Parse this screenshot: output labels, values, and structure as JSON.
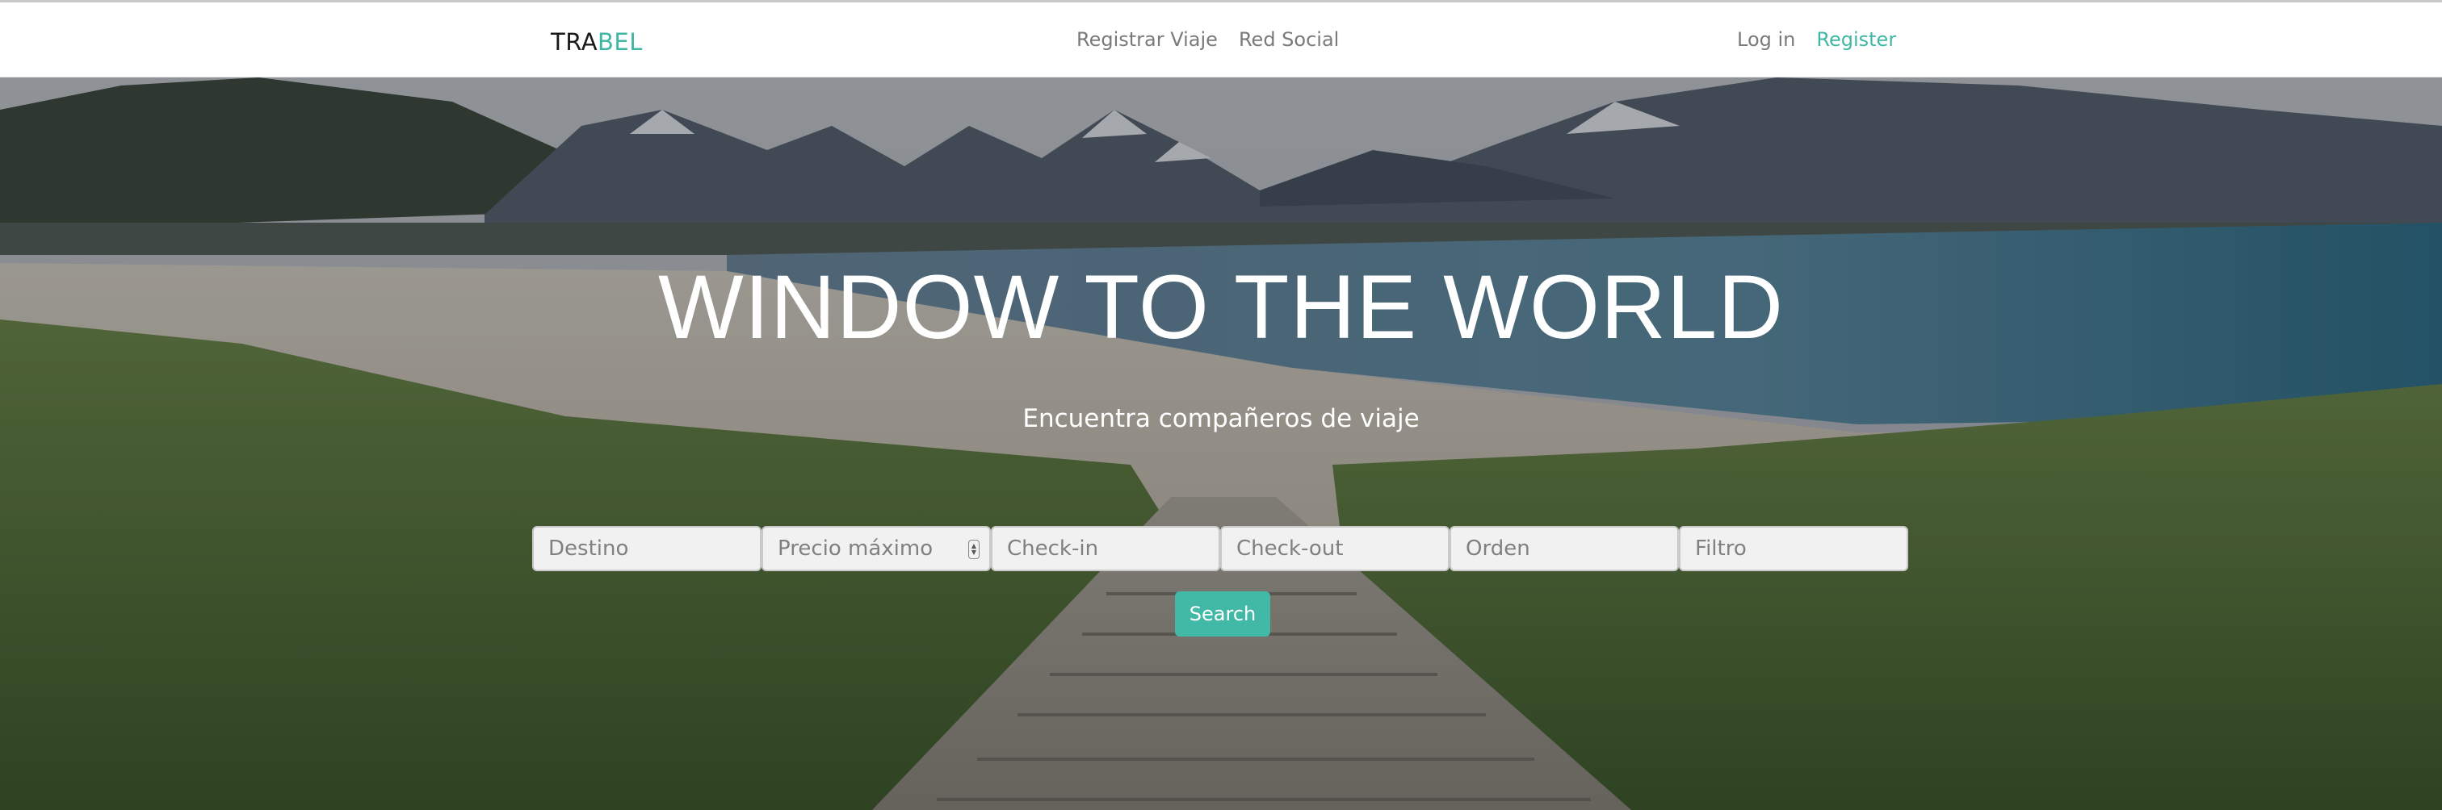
{
  "brand": {
    "prefix": "TRA",
    "accent": "BEL"
  },
  "nav": {
    "center": [
      {
        "label": "Registrar Viaje"
      },
      {
        "label": "Red Social"
      }
    ],
    "login": "Log in",
    "register": "Register"
  },
  "hero": {
    "title": "WINDOW TO THE WORLD",
    "subtitle": "Encuentra compañeros de viaje"
  },
  "search": {
    "fields": [
      {
        "placeholder": "Destino"
      },
      {
        "placeholder": "Precio máximo"
      },
      {
        "placeholder": "Check-in"
      },
      {
        "placeholder": "Check-out"
      },
      {
        "placeholder": "Orden"
      },
      {
        "placeholder": "Filtro"
      }
    ],
    "button": "Search"
  },
  "colors": {
    "accent": "#3fb7a3",
    "button": "#42b8a6"
  }
}
